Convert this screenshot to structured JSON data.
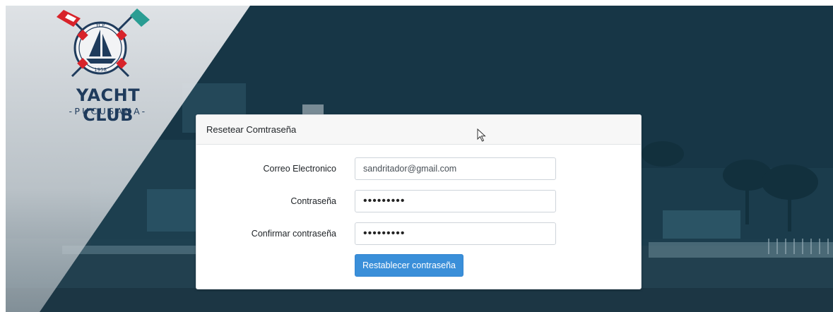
{
  "logo": {
    "badge_top": "YCP",
    "badge_year": "1958",
    "title": "YACHT CLUB",
    "subtitle": "-PUCUSANA-"
  },
  "card": {
    "header": "Resetear Comtraseña",
    "email_label": "Correo Electronico",
    "email_value": "sandritador@gmail.com",
    "password_label": "Contraseña",
    "password_value": "fakepass1",
    "confirm_label": "Confirmar contraseña",
    "confirm_value": "fakepass1",
    "submit_label": "Restablecer contraseña"
  },
  "colors": {
    "button": "#3a8fd9",
    "brand_navy": "#1f3b5c",
    "flag_red": "#d8232a",
    "flag_teal": "#2a9d93"
  },
  "icons": [
    "mouse-cursor-icon",
    "sailboat-icon",
    "signal-flag-icon"
  ]
}
